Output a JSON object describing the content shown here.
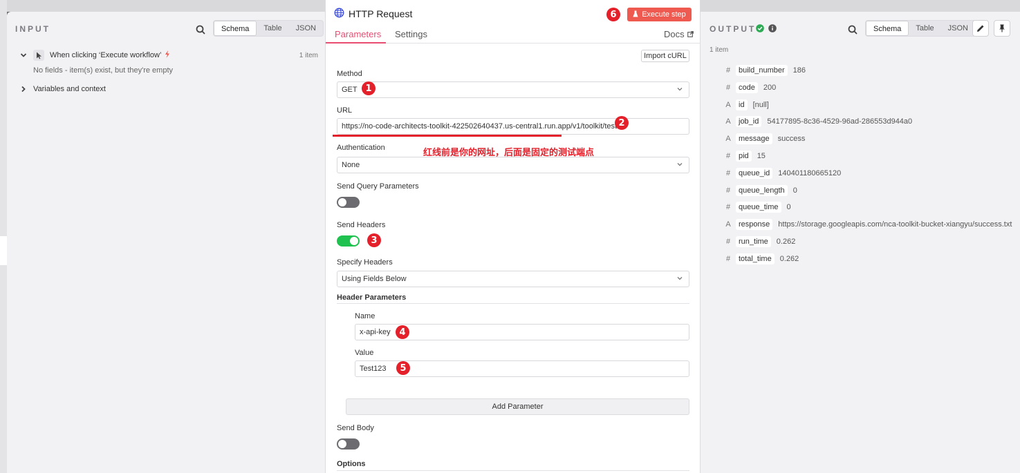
{
  "input": {
    "title": "INPUT",
    "view_tabs": [
      "Schema",
      "Table",
      "JSON"
    ],
    "active_view": "Schema",
    "trigger_label": "When clicking ‘Execute workflow’",
    "trigger_count": "1 item",
    "empty_message": "No fields - item(s) exist, but they're empty",
    "variables_label": "Variables and context"
  },
  "node": {
    "title": "HTTP Request",
    "execute_label": "Execute step",
    "tabs": [
      "Parameters",
      "Settings"
    ],
    "docs_label": "Docs",
    "import_curl_label": "Import cURL",
    "method_label": "Method",
    "method_value": "GET",
    "url_label": "URL",
    "url_value": "https://no-code-architects-toolkit-422502640437.us-central1.run.app/v1/toolkit/test",
    "annotation": "红线前是你的网址，后面是固定的测试端点",
    "auth_label": "Authentication",
    "auth_value": "None",
    "send_query_label": "Send Query Parameters",
    "send_query_on": false,
    "send_headers_label": "Send Headers",
    "send_headers_on": true,
    "specify_headers_label": "Specify Headers",
    "specify_headers_value": "Using Fields Below",
    "header_params_label": "Header Parameters",
    "header_name_label": "Name",
    "header_name_value": "x-api-key",
    "header_value_label": "Value",
    "header_value_value": "Test123",
    "add_parameter_label": "Add Parameter",
    "send_body_label": "Send Body",
    "send_body_on": false,
    "options_label": "Options"
  },
  "badges": [
    "1",
    "2",
    "3",
    "4",
    "5",
    "6"
  ],
  "output": {
    "title": "OUTPUT",
    "count": "1 item",
    "view_tabs": [
      "Schema",
      "Table",
      "JSON"
    ],
    "active_view": "Schema",
    "fields": [
      {
        "type": "#",
        "key": "build_number",
        "value": "186"
      },
      {
        "type": "#",
        "key": "code",
        "value": "200"
      },
      {
        "type": "A",
        "key": "id",
        "value": "[null]"
      },
      {
        "type": "A",
        "key": "job_id",
        "value": "54177895-8c36-4529-96ad-286553d944a0"
      },
      {
        "type": "A",
        "key": "message",
        "value": "success"
      },
      {
        "type": "#",
        "key": "pid",
        "value": "15"
      },
      {
        "type": "#",
        "key": "queue_id",
        "value": "140401180665120"
      },
      {
        "type": "#",
        "key": "queue_length",
        "value": "0"
      },
      {
        "type": "#",
        "key": "queue_time",
        "value": "0"
      },
      {
        "type": "A",
        "key": "response",
        "value": "https://storage.googleapis.com/nca-toolkit-bucket-xiangyu/success.txt"
      },
      {
        "type": "#",
        "key": "run_time",
        "value": "0.262"
      },
      {
        "type": "#",
        "key": "total_time",
        "value": "0.262"
      }
    ]
  },
  "colors": {
    "accent": "#ea4b71",
    "toggle_on": "#1fc24f",
    "toggle_off": "#6b6b70",
    "badge_red": "#e4202a",
    "execute_button": "#ee5a4f",
    "success_green": "#2eaa55"
  },
  "icons": [
    "search-icon",
    "globe-icon",
    "flask-icon",
    "external-link-icon",
    "chevron-down-icon",
    "chevron-right-icon",
    "cursor-icon",
    "lightning-icon",
    "check-circle-icon",
    "info-icon",
    "pencil-icon",
    "pin-icon"
  ]
}
